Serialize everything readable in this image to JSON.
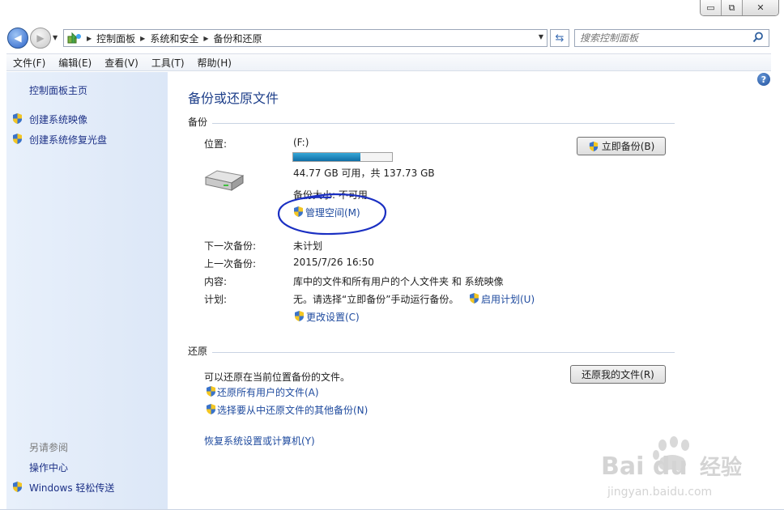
{
  "window": {
    "min_glyph": "▭",
    "max_glyph": "⧉",
    "close_glyph": "✕"
  },
  "nav": {
    "back_glyph": "◀",
    "fwd_glyph": "▶",
    "history_glyph": "▼",
    "breadcrumbs": [
      "控制面板",
      "系统和安全",
      "备份和还原"
    ],
    "sep_glyph": "▶",
    "addr_dropdown_glyph": "▼",
    "refresh_glyph": "⇆",
    "search_placeholder": "搜索控制面板",
    "search_icon": "search-icon"
  },
  "menu": [
    "文件(F)",
    "编辑(E)",
    "查看(V)",
    "工具(T)",
    "帮助(H)"
  ],
  "sidebar": {
    "home": "控制面板主页",
    "tasks": [
      "创建系统映像",
      "创建系统修复光盘"
    ],
    "see_also_header": "另请参阅",
    "see_also": [
      "操作中心",
      "Windows 轻松传送"
    ]
  },
  "help_glyph": "?",
  "main": {
    "title": "备份或还原文件",
    "backup_section": "备份",
    "location_label": "位置:",
    "drive_letter": "(F:)",
    "drive_used_fraction": 0.68,
    "drive_space": "44.77 GB 可用，共 137.73 GB",
    "backup_size": "备份大小: 不可用",
    "manage_space": "管理空间(M)",
    "backup_now": "立即备份(B)",
    "next_backup_label": "下一次备份:",
    "next_backup_value": "未计划",
    "last_backup_label": "上一次备份:",
    "last_backup_value": "2015/7/26 16:50",
    "contents_label": "内容:",
    "contents_value": "库中的文件和所有用户的个人文件夹 和 系统映像",
    "schedule_label": "计划:",
    "schedule_value": "无。请选择“立即备份”手动运行备份。",
    "enable_schedule": "启用计划(U)",
    "change_settings": "更改设置(C)",
    "restore_section": "还原",
    "restore_text": "可以还原在当前位置备份的文件。",
    "restore_my_files": "还原我的文件(R)",
    "restore_all_users": "还原所有用户的文件(A)",
    "select_other_backup": "选择要从中还原文件的其他备份(N)",
    "recover_settings": "恢复系统设置或计算机(Y)"
  },
  "watermark": {
    "brand": "Bai du",
    "cn": "经验",
    "url": "jingyan.baidu.com"
  },
  "colors": {
    "link": "#1e4a9e",
    "sidebar_link": "#1e3287",
    "title": "#1e3f8a",
    "progress": "#1f86be",
    "annotation": "#1a2fc2"
  }
}
